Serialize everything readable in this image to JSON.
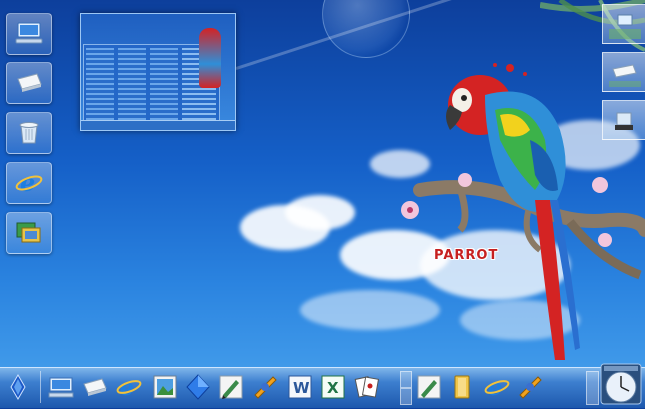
{
  "wallpaper": {
    "caption": "PARROT",
    "colors": {
      "sky_top": "#0d3f9c",
      "sky_bottom": "#4aa4ee",
      "parrot_red": "#d42323"
    }
  },
  "desktop_icons": [
    {
      "name": "computer-icon"
    },
    {
      "name": "network-drive-icon"
    },
    {
      "name": "recycle-bin-icon"
    },
    {
      "name": "internet-explorer-icon"
    },
    {
      "name": "control-panel-icon"
    }
  ],
  "taskbar": {
    "start": {
      "icon": "start-orb-icon"
    },
    "items": [
      {
        "icon": "computer-icon"
      },
      {
        "icon": "drive-icon"
      },
      {
        "icon": "internet-explorer-icon"
      },
      {
        "icon": "image-icon"
      },
      {
        "icon": "diamond-icon"
      },
      {
        "icon": "pen-tool-icon"
      },
      {
        "icon": "media-player-icon"
      },
      {
        "icon": "word-icon",
        "letter": "W"
      },
      {
        "icon": "excel-icon",
        "letter": "X"
      },
      {
        "icon": "cards-icon"
      },
      {
        "icon": "pen-tool-icon"
      },
      {
        "icon": "folder-icon"
      },
      {
        "icon": "internet-explorer-icon"
      },
      {
        "icon": "media-player-icon"
      }
    ]
  }
}
